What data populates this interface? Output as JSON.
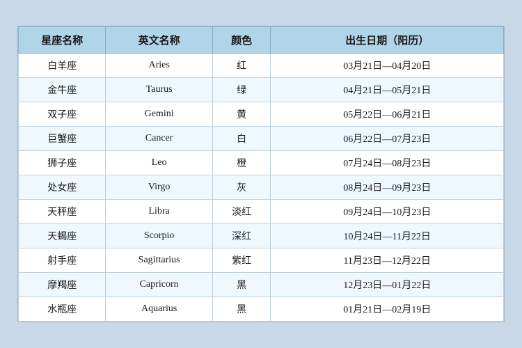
{
  "table": {
    "headers": [
      "星座名称",
      "英文名称",
      "颜色",
      "出生日期（阳历）"
    ],
    "rows": [
      {
        "chinese": "白羊座",
        "english": "Aries",
        "color": "红",
        "date": "03月21日—04月20日"
      },
      {
        "chinese": "金牛座",
        "english": "Taurus",
        "color": "绿",
        "date": "04月21日—05月21日"
      },
      {
        "chinese": "双子座",
        "english": "Gemini",
        "color": "黄",
        "date": "05月22日—06月21日"
      },
      {
        "chinese": "巨蟹座",
        "english": "Cancer",
        "color": "白",
        "date": "06月22日—07月23日"
      },
      {
        "chinese": "狮子座",
        "english": "Leo",
        "color": "橙",
        "date": "07月24日—08月23日"
      },
      {
        "chinese": "处女座",
        "english": "Virgo",
        "color": "灰",
        "date": "08月24日—09月23日"
      },
      {
        "chinese": "天秤座",
        "english": "Libra",
        "color": "淡红",
        "date": "09月24日—10月23日"
      },
      {
        "chinese": "天蝎座",
        "english": "Scorpio",
        "color": "深红",
        "date": "10月24日—11月22日"
      },
      {
        "chinese": "射手座",
        "english": "Sagittarius",
        "color": "紫红",
        "date": "11月23日—12月22日"
      },
      {
        "chinese": "摩羯座",
        "english": "Capricorn",
        "color": "黑",
        "date": "12月23日—01月22日"
      },
      {
        "chinese": "水瓶座",
        "english": "Aquarius",
        "color": "黑",
        "date": "01月21日—02月19日"
      }
    ]
  }
}
